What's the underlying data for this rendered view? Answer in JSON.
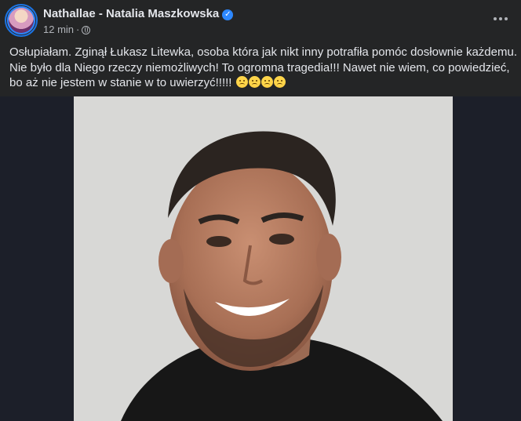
{
  "post": {
    "author": "Nathallae - Natalia Maszkowska",
    "verified_icon": "verified-badge-icon",
    "time": "12 min",
    "separator": "·",
    "privacy_icon": "globe-icon",
    "text": "Osłupiałam. Zginął Łukasz Litewka, osoba która jak nikt inny potrafiła pomóc dosłownie każdemu. Nie było dla Niego rzeczy niemożliwych! To ogromna tragedia!!! Nawet nie wiem, co powiedzieć, bo aż nie jestem w stanie w to uwierzyć!!!!!",
    "emoji_icons": [
      "sad-face-icon",
      "sad-face-icon",
      "sad-face-icon",
      "sad-face-icon"
    ]
  },
  "colors": {
    "background": "#242526",
    "text": "#e4e6eb",
    "secondary_text": "#b0b3b8",
    "accent": "#2d88ff"
  }
}
